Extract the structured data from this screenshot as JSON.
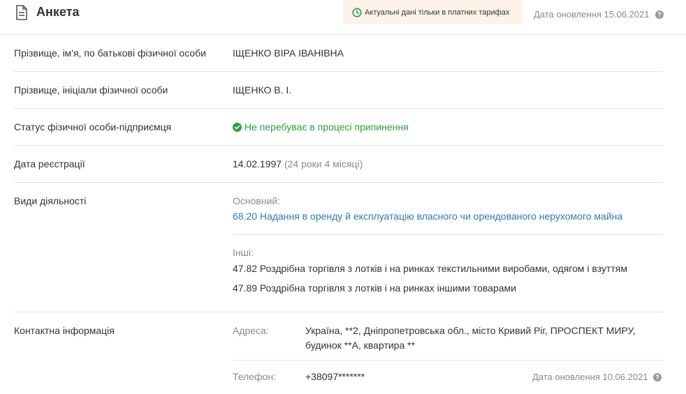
{
  "header": {
    "title": "Анкета",
    "promo_text": "Актуальні дані тільки в платних тарифах",
    "update_date": "Дата оновлення 15.06.2021"
  },
  "rows": {
    "full_name": {
      "label": "Прізвище, ім'я, по батькові фізичної особи",
      "value": "ІЩЕНКО ВІРА ІВАНІВНА"
    },
    "short_name": {
      "label": "Прізвище, ініціали фізичної особи",
      "value": "ІЩЕНКО В. І."
    },
    "status": {
      "label": "Статус фізичної особи-підприємця",
      "value": "Не перебуває в процесі припинення"
    },
    "reg_date": {
      "label": "Дата реєстрації",
      "value": "14.02.1997",
      "age": "(24 роки 4 місяці)"
    },
    "activities": {
      "label": "Види діяльності",
      "main_title": "Основний:",
      "main_item": "68.20 Надання в оренду й експлуатацію власного чи орендованого нерухомого майна",
      "other_title": "Інші:",
      "other_items": [
        "47.82 Роздрібна торгівля з лотків і на ринках текстильними виробами, одягом і взуттям",
        "47.89 Роздрібна торгівля з лотків і на ринках іншими товарами"
      ]
    },
    "contacts": {
      "label": "Контактна інформація",
      "address_label": "Адреса:",
      "address_line1": "Україна, **2, Дніпропетровська обл., місто Кривий Ріг, ПРОСПЕКТ МИРУ,",
      "address_line2": "будинок **А, квартира **",
      "phone_label": "Телефон:",
      "phone_value": "+38097*******",
      "phone_update": "Дата оновлення 10.06.2021"
    }
  },
  "icons": {
    "header": "document-icon",
    "promo": "clock-icon",
    "help": "question-icon",
    "status": "check-circle-icon"
  },
  "colors": {
    "green": "#2e9e47",
    "link": "#2a7ab8",
    "promo_bg": "#fdf3e9",
    "muted": "#8a8a8a"
  }
}
